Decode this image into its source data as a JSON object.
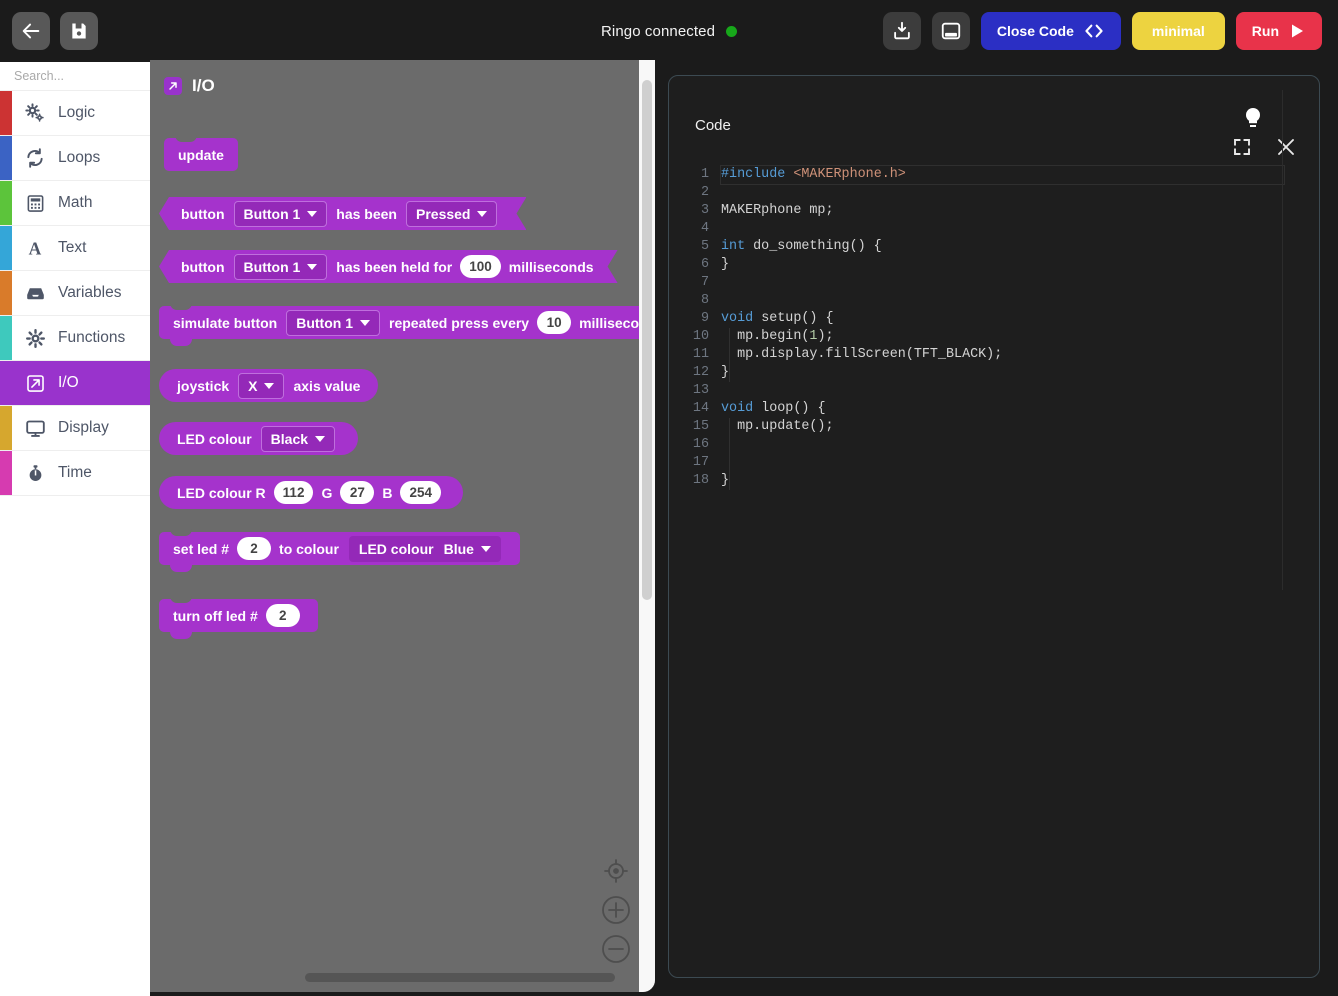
{
  "toolbar": {
    "back_icon": "arrow-left-icon",
    "save_icon": "save-icon",
    "status_text": "Ringo connected",
    "status_color": "#17a81a",
    "download_icon": "download-icon",
    "panel_icon": "panel-toggle-icon",
    "close_code_label": "Close Code",
    "close_code_icon": "code-brackets-icon",
    "close_code_color": "#2b2fc4",
    "minimal_label": "minimal",
    "minimal_color": "#edd340",
    "run_label": "Run",
    "run_icon": "play-icon",
    "run_color": "#e8334a"
  },
  "sidebar": {
    "search_placeholder": "Search...",
    "search_value": "",
    "search_icon": "search-icon",
    "items": [
      {
        "label": "Logic",
        "color": "#cc3333",
        "icon": "gears-icon",
        "active": false
      },
      {
        "label": "Loops",
        "color": "#3b63c4",
        "icon": "loop-icon",
        "active": false
      },
      {
        "label": "Math",
        "color": "#5cc43b",
        "icon": "calculator-icon",
        "active": false
      },
      {
        "label": "Text",
        "color": "#34a6d8",
        "icon": "letter-a-icon",
        "active": false
      },
      {
        "label": "Variables",
        "color": "#d97b2a",
        "icon": "inbox-icon",
        "active": false
      },
      {
        "label": "Functions",
        "color": "#3ec9bd",
        "icon": "gear-icon",
        "active": false
      },
      {
        "label": "I/O",
        "color": "#9933cc",
        "icon": "io-arrow-icon",
        "active": true
      },
      {
        "label": "Display",
        "color": "#d6a72e",
        "icon": "monitor-icon",
        "active": false
      },
      {
        "label": "Time",
        "color": "#d63bb0",
        "icon": "stopwatch-icon",
        "active": false
      }
    ]
  },
  "flyout": {
    "title": "I/O",
    "accent": "#9933cc",
    "block_color": "#a533cc",
    "blocks": [
      {
        "kind": "hat",
        "parts": [
          {
            "t": "text",
            "v": "update"
          }
        ]
      },
      {
        "kind": "bool",
        "parts": [
          {
            "t": "text",
            "v": "button"
          },
          {
            "t": "dropdown",
            "v": "Button 1"
          },
          {
            "t": "text",
            "v": "has been"
          },
          {
            "t": "dropdown",
            "v": "Pressed"
          }
        ]
      },
      {
        "kind": "bool",
        "parts": [
          {
            "t": "text",
            "v": "button"
          },
          {
            "t": "dropdown",
            "v": "Button 1"
          },
          {
            "t": "text",
            "v": "has been held for"
          },
          {
            "t": "number",
            "v": "100"
          },
          {
            "t": "text",
            "v": "milliseconds"
          }
        ]
      },
      {
        "kind": "stack",
        "parts": [
          {
            "t": "text",
            "v": "simulate button"
          },
          {
            "t": "dropdown",
            "v": "Button 1"
          },
          {
            "t": "text",
            "v": "repeated press every"
          },
          {
            "t": "number",
            "v": "10"
          },
          {
            "t": "text",
            "v": "milliseconds"
          }
        ]
      },
      {
        "kind": "round",
        "parts": [
          {
            "t": "text",
            "v": "joystick"
          },
          {
            "t": "dropdown",
            "v": "X"
          },
          {
            "t": "text",
            "v": "axis value"
          }
        ]
      },
      {
        "kind": "round",
        "parts": [
          {
            "t": "text",
            "v": "LED colour"
          },
          {
            "t": "dropdown",
            "v": "Black"
          }
        ]
      },
      {
        "kind": "round",
        "parts": [
          {
            "t": "text",
            "v": "LED colour R"
          },
          {
            "t": "number",
            "v": "112"
          },
          {
            "t": "text",
            "v": "G"
          },
          {
            "t": "number",
            "v": "27"
          },
          {
            "t": "text",
            "v": "B"
          },
          {
            "t": "number",
            "v": "254"
          }
        ]
      },
      {
        "kind": "stack",
        "parts": [
          {
            "t": "text",
            "v": "set led #"
          },
          {
            "t": "number",
            "v": "2"
          },
          {
            "t": "text",
            "v": "to colour"
          },
          {
            "t": "inner",
            "v": "LED colour"
          },
          {
            "t": "innerdd",
            "v": "Blue"
          }
        ]
      },
      {
        "kind": "stack",
        "parts": [
          {
            "t": "text",
            "v": "turn off led #"
          },
          {
            "t": "number",
            "v": "2"
          }
        ]
      }
    ],
    "workspace_ghost_label": "do_something"
  },
  "workspace": {
    "center_icon": "crosshair-icon",
    "zoom_in_icon": "plus-circle-icon",
    "zoom_out_icon": "minus-circle-icon"
  },
  "code_panel": {
    "title": "Code",
    "hint_icon": "lightbulb-icon",
    "expand_icon": "fullscreen-icon",
    "close_icon": "close-icon",
    "lines": [
      {
        "n": "1",
        "text": "#include <MAKERphone.h>",
        "current": true
      },
      {
        "n": "2",
        "text": ""
      },
      {
        "n": "3",
        "text": "MAKERphone mp;"
      },
      {
        "n": "4",
        "text": ""
      },
      {
        "n": "5",
        "text": "int do_something() {"
      },
      {
        "n": "6",
        "text": "}"
      },
      {
        "n": "7",
        "text": ""
      },
      {
        "n": "8",
        "text": ""
      },
      {
        "n": "9",
        "text": "void setup() {"
      },
      {
        "n": "10",
        "text": "  mp.begin(1);"
      },
      {
        "n": "11",
        "text": "  mp.display.fillScreen(TFT_BLACK);"
      },
      {
        "n": "12",
        "text": "}"
      },
      {
        "n": "13",
        "text": ""
      },
      {
        "n": "14",
        "text": "void loop() {"
      },
      {
        "n": "15",
        "text": "  mp.update();"
      },
      {
        "n": "16",
        "text": ""
      },
      {
        "n": "17",
        "text": ""
      },
      {
        "n": "18",
        "text": "}"
      }
    ]
  }
}
